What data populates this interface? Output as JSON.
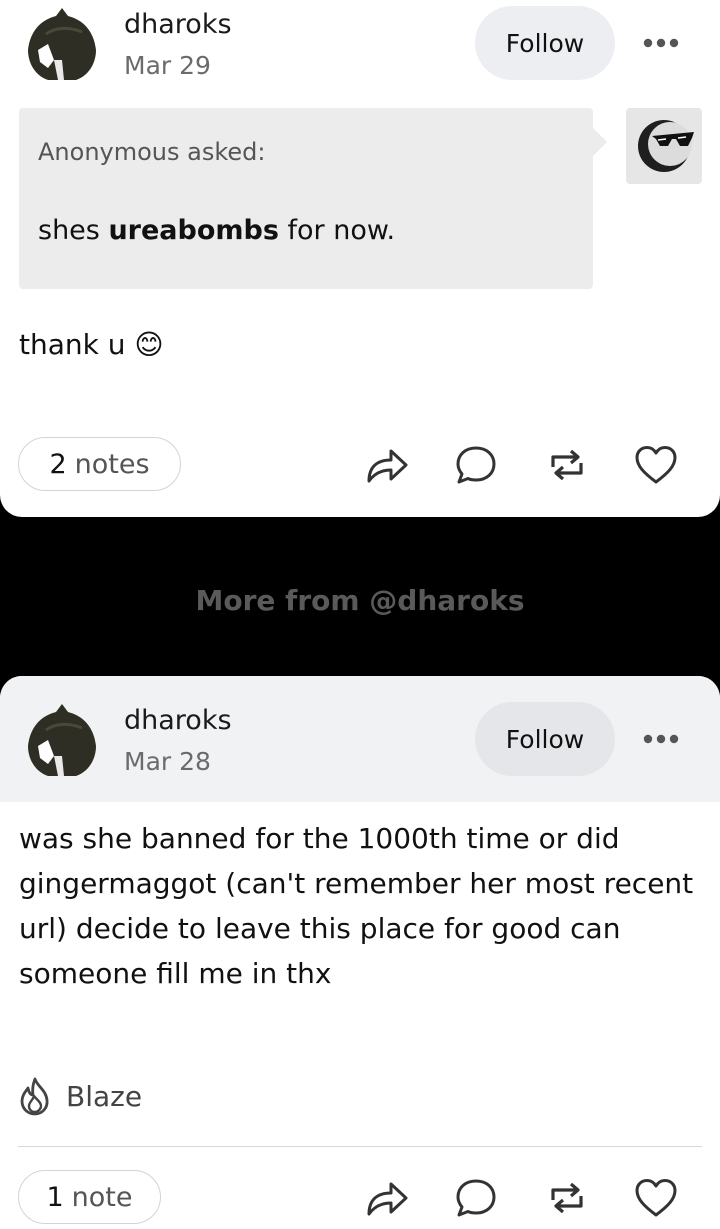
{
  "posts": [
    {
      "author": "dharoks",
      "date": "Mar 29",
      "follow_label": "Follow",
      "ask": {
        "asker": "Anonymous",
        "asked_label": "asked:",
        "question_pre": "shes ",
        "question_bold": "ureabombs",
        "question_post": " for now."
      },
      "answer": "thank u 😊",
      "notes_count": "2",
      "notes_label": "notes"
    },
    {
      "author": "dharoks",
      "date": "Mar 28",
      "follow_label": "Follow",
      "body_lines": [
        "was she banned for the 1000th time or did",
        "gingermaggot (can't remember her most recent",
        "url) decide to leave this place for good can",
        "someone fill me in thx"
      ],
      "blaze_label": "Blaze",
      "notes_count": "1",
      "notes_label": "note"
    }
  ],
  "more_from": "More from @dharoks",
  "icons": {
    "more": "more-dots-icon",
    "share": "share-icon",
    "reply": "reply-icon",
    "reblog": "reblog-icon",
    "like": "heart-icon",
    "blaze": "flame-icon"
  },
  "colors": {
    "page_bg": "#000000",
    "card_bg": "#ffffff",
    "header_band": "#f1f2f4",
    "ask_bg": "#ececec",
    "follow_bg": "#eceef1"
  }
}
